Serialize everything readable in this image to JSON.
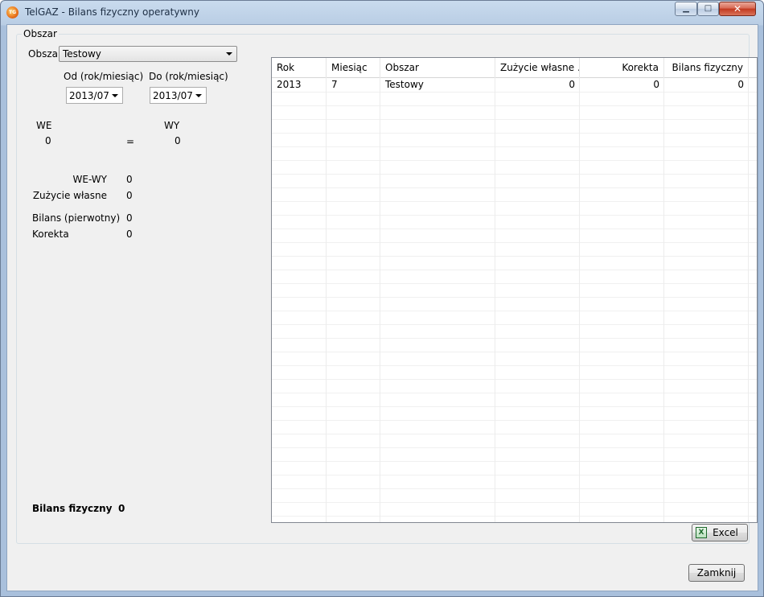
{
  "window": {
    "title": "TelGAZ - Bilans fizyczny operatywny",
    "icon_text": "TG",
    "minimize_glyph": "▁",
    "maximize_glyph": "□",
    "close_glyph": "✕"
  },
  "groupbox": {
    "title": "Obszar"
  },
  "filter": {
    "area_label": "Obszar",
    "area_value": "Testowy",
    "from_label": "Od (rok/miesiąc)",
    "from_value": "2013/07",
    "to_label": "Do (rok/miesiąc)",
    "to_value": "2013/07"
  },
  "summary": {
    "we_label": "WE",
    "wy_label": "WY",
    "we_value": "0",
    "equals": "=",
    "wy_value": "0",
    "we_wy_label": "WE-WY",
    "we_wy_value": "0",
    "own_use_label": "Zużycie własne",
    "own_use_value": "0",
    "initial_balance_label": "Bilans (pierwotny)",
    "initial_balance_value": "0",
    "correction_label": "Korekta",
    "correction_value": "0",
    "physical_balance_label": "Bilans fizyczny",
    "physical_balance_value": "0"
  },
  "table": {
    "columns": [
      "Rok",
      "Miesiąc",
      "Obszar",
      "Zużycie własne ...",
      "Korekta",
      "Bilans fizyczny"
    ],
    "rows": [
      [
        "2013",
        "7",
        "Testowy",
        "0",
        "0",
        "0"
      ]
    ]
  },
  "buttons": {
    "excel_label": "Excel",
    "excel_icon_text": "X",
    "close_label": "Zamknij"
  },
  "colors": {
    "title_bar": "#b9cde4",
    "client_background": "#f0f0f0",
    "close_button": "#c2391f"
  }
}
